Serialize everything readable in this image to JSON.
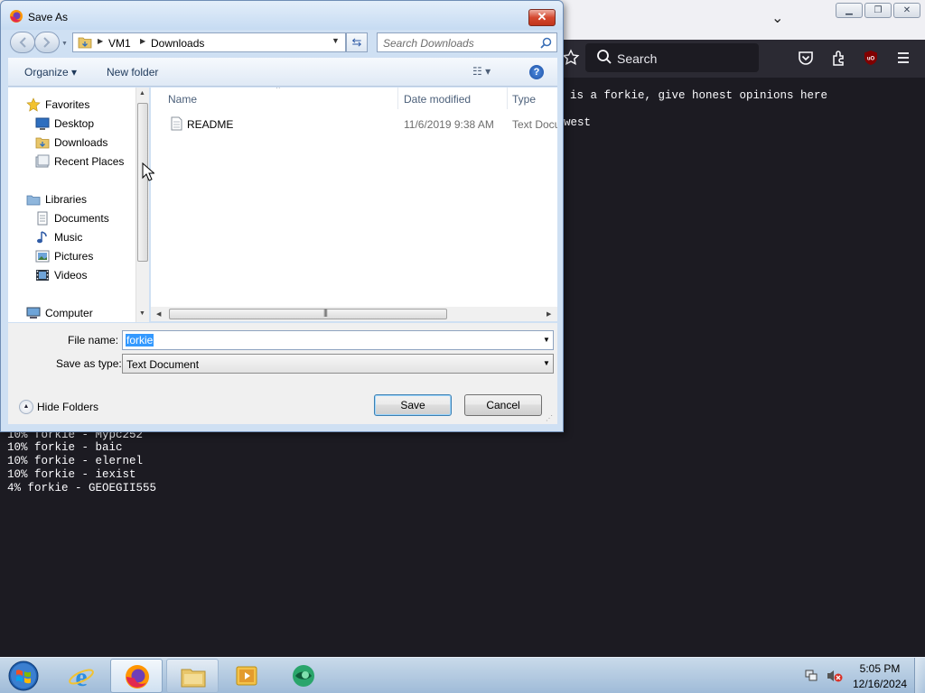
{
  "firefox": {
    "toolbar": {
      "search_placeholder": "Search"
    },
    "content_lines": [
      "is a forkie, give honest opinions here",
      "west",
      "10% forkie - Mypc252",
      "10% forkie - baic",
      "10% forkie - elernel",
      "10% forkie - iexist",
      "4% forkie - GEOEGII555"
    ]
  },
  "dialog": {
    "title": "Save As",
    "breadcrumb": [
      "VM1",
      "Downloads"
    ],
    "search_placeholder": "Search Downloads",
    "commands": {
      "organize": "Organize ▾",
      "new_folder": "New folder"
    },
    "nav": {
      "favorites": "Favorites",
      "desktop": "Desktop",
      "downloads": "Downloads",
      "recent_places": "Recent Places",
      "libraries": "Libraries",
      "documents": "Documents",
      "music": "Music",
      "pictures": "Pictures",
      "videos": "Videos",
      "computer": "Computer"
    },
    "columns": {
      "name": "Name",
      "date_modified": "Date modified",
      "type": "Type"
    },
    "files": [
      {
        "name": "README",
        "date_modified": "11/6/2019 9:38 AM",
        "type": "Text Document"
      }
    ],
    "file_name_label": "File name:",
    "file_name_value": "forkie",
    "save_type_label": "Save as type:",
    "save_type_value": "Text Document",
    "hide_folders": "Hide Folders",
    "save_button": "Save",
    "cancel_button": "Cancel"
  },
  "taskbar": {
    "clock_time": "5:05 PM",
    "clock_date": "12/16/2024"
  },
  "colors": {
    "firefox_content_bg": "#1c1b22",
    "selection": "#3399ff",
    "dialog_frame": "#cfe0f3"
  },
  "icons": [
    "firefox-icon",
    "folder-icon",
    "star-icon",
    "search-icon",
    "help-icon",
    "pocket-icon",
    "extensions-icon",
    "ublock-icon",
    "menu-icon"
  ]
}
